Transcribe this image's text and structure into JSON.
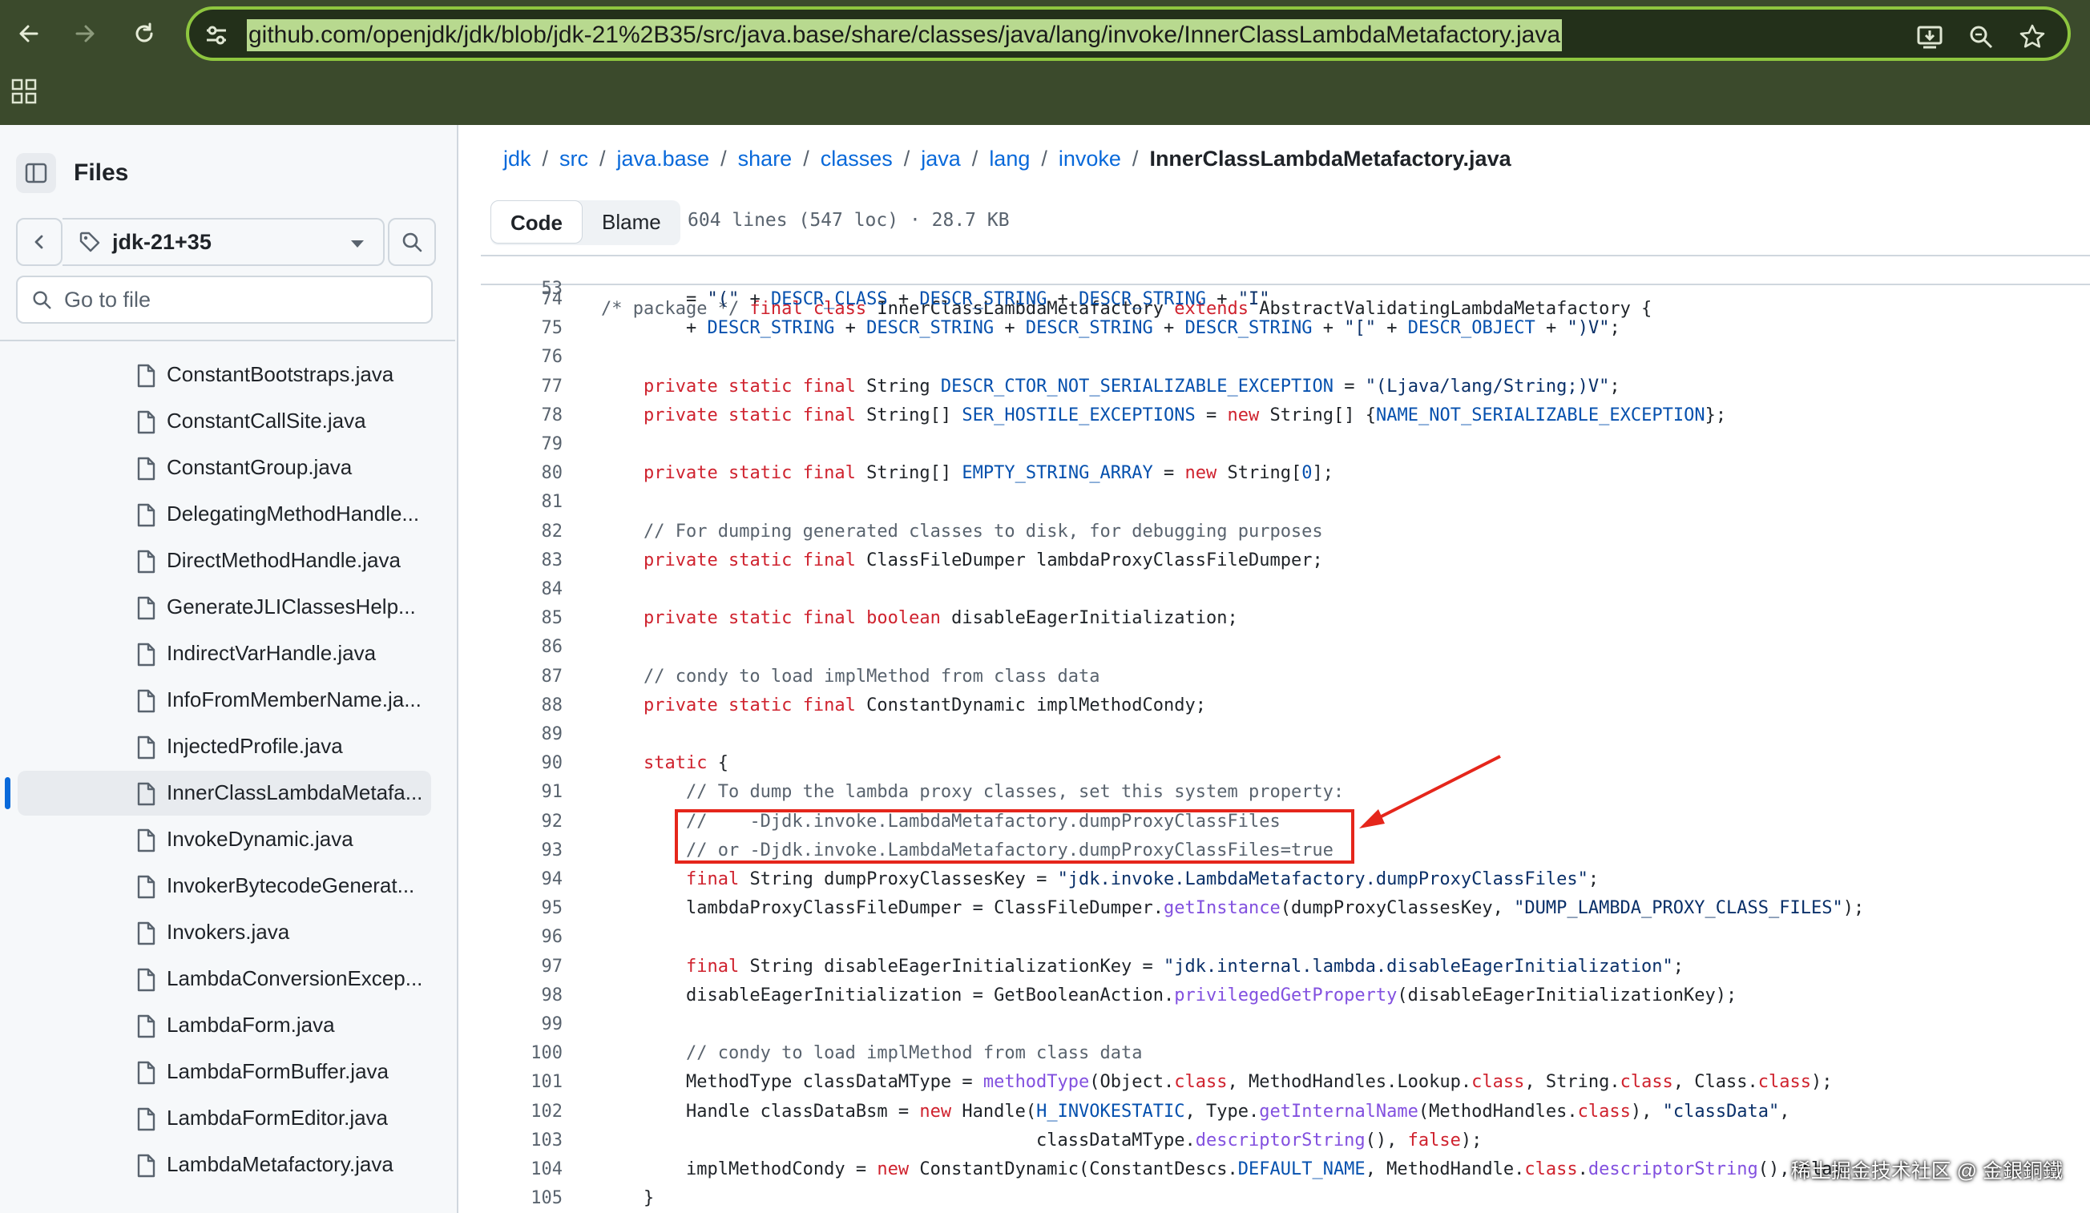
{
  "browser": {
    "url": "github.com/openjdk/jdk/blob/jdk-21%2B35/src/java.base/share/classes/java/lang/invoke/InnerClassLambdaMetafactory.java",
    "back_icon": "arrow-left-icon",
    "forward_icon": "arrow-right-icon",
    "reload_icon": "reload-icon",
    "colors": {
      "toolbar": "#3b4a2c",
      "accent": "#8ec63f"
    }
  },
  "sidebar": {
    "title": "Files",
    "branch": "jdk-21+35",
    "goto_placeholder": "Go to file",
    "files": [
      "ConstantBootstraps.java",
      "ConstantCallSite.java",
      "ConstantGroup.java",
      "DelegatingMethodHandle...",
      "DirectMethodHandle.java",
      "GenerateJLIClassesHelp...",
      "IndirectVarHandle.java",
      "InfoFromMemberName.ja...",
      "InjectedProfile.java",
      "InnerClassLambdaMetafa...",
      "InvokeDynamic.java",
      "InvokerBytecodeGenerat...",
      "Invokers.java",
      "LambdaConversionExcep...",
      "LambdaForm.java",
      "LambdaFormBuffer.java",
      "LambdaFormEditor.java",
      "LambdaMetafactory.java"
    ],
    "active_index": 9
  },
  "breadcrumb": {
    "items": [
      "jdk",
      "src",
      "java.base",
      "share",
      "classes",
      "java",
      "lang",
      "invoke"
    ],
    "current": "InnerClassLambdaMetafactory.java"
  },
  "tabs": {
    "code": "Code",
    "blame": "Blame"
  },
  "file_meta": "604 lines (547 loc) · 28.7 KB",
  "sticky": {
    "ln": "53",
    "code": "/* package */ final class InnerClassLambdaMetafactory extends AbstractValidatingLambdaMetafactory {"
  },
  "code_lines": [
    {
      "ln": "74",
      "code": "        = \"(\" + DESCR_CLASS + DESCR_STRING + DESCR_STRING + \"I\""
    },
    {
      "ln": "75",
      "code": "        + DESCR_STRING + DESCR_STRING + DESCR_STRING + DESCR_STRING + \"[\" + DESCR_OBJECT + \")V\";"
    },
    {
      "ln": "76",
      "code": ""
    },
    {
      "ln": "77",
      "code": "    private static final String DESCR_CTOR_NOT_SERIALIZABLE_EXCEPTION = \"(Ljava/lang/String;)V\";"
    },
    {
      "ln": "78",
      "code": "    private static final String[] SER_HOSTILE_EXCEPTIONS = new String[] {NAME_NOT_SERIALIZABLE_EXCEPTION};"
    },
    {
      "ln": "79",
      "code": ""
    },
    {
      "ln": "80",
      "code": "    private static final String[] EMPTY_STRING_ARRAY = new String[0];"
    },
    {
      "ln": "81",
      "code": ""
    },
    {
      "ln": "82",
      "code": "    // For dumping generated classes to disk, for debugging purposes"
    },
    {
      "ln": "83",
      "code": "    private static final ClassFileDumper lambdaProxyClassFileDumper;"
    },
    {
      "ln": "84",
      "code": ""
    },
    {
      "ln": "85",
      "code": "    private static final boolean disableEagerInitialization;"
    },
    {
      "ln": "86",
      "code": ""
    },
    {
      "ln": "87",
      "code": "    // condy to load implMethod from class data"
    },
    {
      "ln": "88",
      "code": "    private static final ConstantDynamic implMethodCondy;"
    },
    {
      "ln": "89",
      "code": ""
    },
    {
      "ln": "90",
      "code": "    static {"
    },
    {
      "ln": "91",
      "code": "        // To dump the lambda proxy classes, set this system property:"
    },
    {
      "ln": "92",
      "code": "        //    -Djdk.invoke.LambdaMetafactory.dumpProxyClassFiles"
    },
    {
      "ln": "93",
      "code": "        // or -Djdk.invoke.LambdaMetafactory.dumpProxyClassFiles=true"
    },
    {
      "ln": "94",
      "code": "        final String dumpProxyClassesKey = \"jdk.invoke.LambdaMetafactory.dumpProxyClassFiles\";"
    },
    {
      "ln": "95",
      "code": "        lambdaProxyClassFileDumper = ClassFileDumper.getInstance(dumpProxyClassesKey, \"DUMP_LAMBDA_PROXY_CLASS_FILES\");"
    },
    {
      "ln": "96",
      "code": ""
    },
    {
      "ln": "97",
      "code": "        final String disableEagerInitializationKey = \"jdk.internal.lambda.disableEagerInitialization\";"
    },
    {
      "ln": "98",
      "code": "        disableEagerInitialization = GetBooleanAction.privilegedGetProperty(disableEagerInitializationKey);"
    },
    {
      "ln": "99",
      "code": ""
    },
    {
      "ln": "100",
      "code": "        // condy to load implMethod from class data"
    },
    {
      "ln": "101",
      "code": "        MethodType classDataMType = methodType(Object.class, MethodHandles.Lookup.class, String.class, Class.class);"
    },
    {
      "ln": "102",
      "code": "        Handle classDataBsm = new Handle(H_INVOKESTATIC, Type.getInternalName(MethodHandles.class), \"classData\","
    },
    {
      "ln": "103",
      "code": "                                         classDataMType.descriptorString(), false);"
    },
    {
      "ln": "104",
      "code": "        implMethodCondy = new ConstantDynamic(ConstantDescs.DEFAULT_NAME, MethodHandle.class.descriptorString(), clas"
    },
    {
      "ln": "105",
      "code": "    }"
    }
  ],
  "annotation_color": "#e5261b",
  "watermark": "稀土掘金技术社区 @ 金銀銅鐵"
}
